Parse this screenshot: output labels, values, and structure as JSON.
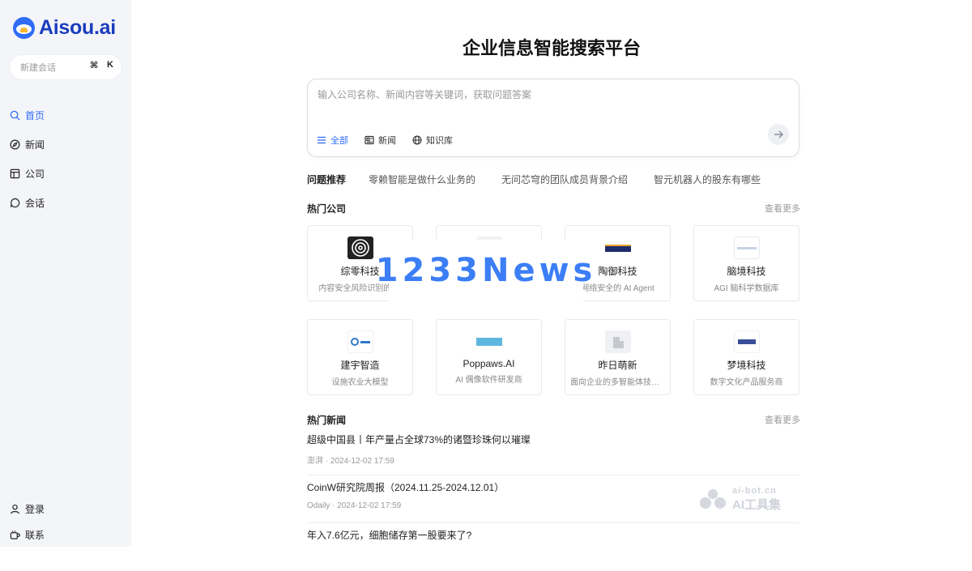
{
  "brand": {
    "name": "Aisou.ai"
  },
  "sidebar": {
    "new_chat": {
      "label": "新建会话",
      "shortcut_cmd": "⌘",
      "shortcut_key": "K"
    },
    "nav": [
      {
        "label": "首页",
        "icon": "search-icon",
        "active": true
      },
      {
        "label": "新闻",
        "icon": "compass-icon"
      },
      {
        "label": "公司",
        "icon": "layout-icon"
      },
      {
        "label": "会话",
        "icon": "chat-icon"
      }
    ],
    "bottom": [
      {
        "label": "登录",
        "icon": "user-icon"
      },
      {
        "label": "联系",
        "icon": "cup-icon"
      }
    ]
  },
  "main": {
    "title": "企业信息智能搜索平台",
    "search": {
      "placeholder": "输入公司名称、新闻内容等关键词，获取问题答案",
      "filters": [
        {
          "label": "全部",
          "icon": "list-icon",
          "active": true
        },
        {
          "label": "新闻",
          "icon": "news-icon"
        },
        {
          "label": "知识库",
          "icon": "globe-icon"
        }
      ]
    },
    "suggestions": {
      "label": "问题推荐",
      "items": [
        "零赖智能是做什么业务的",
        "无问芯穹的团队成员背景介绍",
        "智元机器人的股东有哪些"
      ]
    },
    "hot_companies": {
      "title": "热门公司",
      "more": "查看更多",
      "items": [
        {
          "name": "综零科技",
          "desc": "内容安全风险识别的 AI",
          "logo_color": "#222222"
        },
        {
          "name": "",
          "desc": "",
          "logo_color": "#eeeeee"
        },
        {
          "name": "陶御科技",
          "desc": "网络安全的 AI Agent",
          "logo_color": "#1f2c6b"
        },
        {
          "name": "脑境科技",
          "desc": "AGI 脑科学数据库",
          "logo_color": "#dfe6f2"
        },
        {
          "name": "建宇智造",
          "desc": "设施农业大模型",
          "logo_color": "#2f78c8"
        },
        {
          "name": "Poppaws.AI",
          "desc": "AI 偶像软件研发商",
          "logo_color": "#5fb6e0"
        },
        {
          "name": "昨日萌新",
          "desc": "面向企业的多智能体技术平台",
          "logo_color": "#cccccc"
        },
        {
          "name": "梦境科技",
          "desc": "数字文化产品服务商",
          "logo_color": "#3a4f9a"
        }
      ]
    },
    "hot_news": {
      "title": "热门新闻",
      "more": "查看更多",
      "items": [
        {
          "title": "超级中国县丨年产量占全球73%的诸暨珍珠何以璀璨",
          "source": "澎湃",
          "time": "2024-12-02 17:59"
        },
        {
          "title": "CoinW研究院周报（2024.11.25-2024.12.01）",
          "source": "Odaily",
          "time": "2024-12-02 17:59"
        },
        {
          "title": "年入7.6亿元，细胞储存第一股要来了?",
          "source": "",
          "time": ""
        }
      ]
    }
  },
  "watermarks": {
    "center": "1233News",
    "corner_top": "ai-bot.cn",
    "corner_bottom": "AI工具集"
  },
  "colors": {
    "accent": "#2f6df6",
    "sidebar_bg": "#f4f5f9",
    "brand": "#1b3dbd"
  }
}
